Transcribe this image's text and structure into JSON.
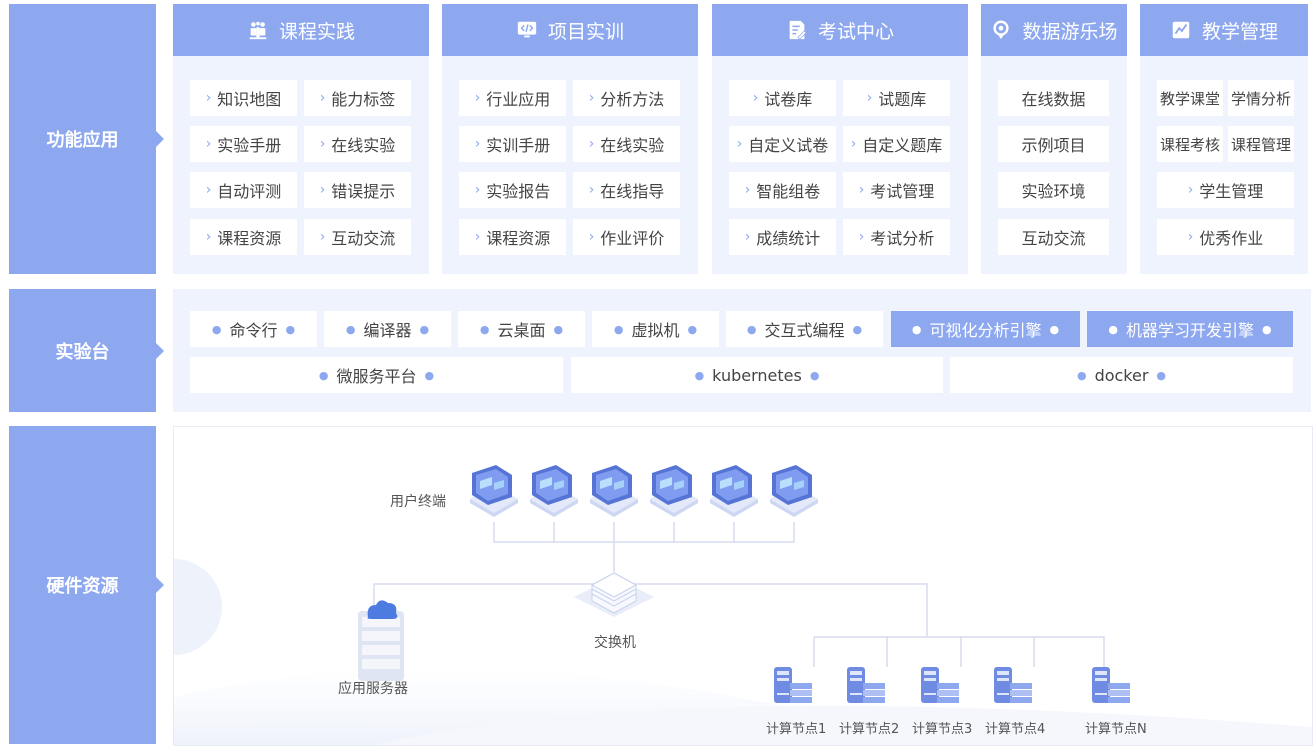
{
  "sections": {
    "function": "功能应用",
    "lab": "实验台",
    "hardware": "硬件资源"
  },
  "columns": [
    {
      "title": "课程实践",
      "icon": "people-icon",
      "items": [
        "知识地图",
        "能力标签",
        "实验手册",
        "在线实验",
        "自动评测",
        "错误提示",
        "课程资源",
        "互动交流"
      ]
    },
    {
      "title": "项目实训",
      "icon": "monitor-code-icon",
      "items": [
        "行业应用",
        "分析方法",
        "实训手册",
        "在线实验",
        "实验报告",
        "在线指导",
        "课程资源",
        "作业评价"
      ]
    },
    {
      "title": "考试中心",
      "icon": "exam-edit-icon",
      "items": [
        "试卷库",
        "试题库",
        "自定义试卷",
        "自定义题库",
        "智能组卷",
        "考试管理",
        "成绩统计",
        "考试分析"
      ]
    },
    {
      "title": "数据游乐场",
      "icon": "location-ring-icon",
      "items": [
        "在线数据",
        "示例项目",
        "实验环境",
        "互动交流"
      ]
    },
    {
      "title": "教学管理",
      "icon": "chart-line-icon",
      "items": [
        "教学课堂",
        "学情分析",
        "课程考核",
        "课程管理",
        "学生管理",
        "优秀作业"
      ]
    }
  ],
  "lab_items": [
    "命令行",
    "编译器",
    "云桌面",
    "虚拟机",
    "交互式编程",
    "可视化分析引擎",
    "机器学习开发引擎",
    "微服务平台",
    "kubernetes",
    "docker"
  ],
  "hardware": {
    "user_terminal": "用户终端",
    "switch": "交换机",
    "app_server": "应用服务器",
    "nodes": [
      "计算节点1",
      "计算节点2",
      "计算节点3",
      "计算节点4",
      "计算节点N"
    ]
  },
  "colors": {
    "accent": "#8ea8f0",
    "panel_bg": "#eef3fd"
  }
}
